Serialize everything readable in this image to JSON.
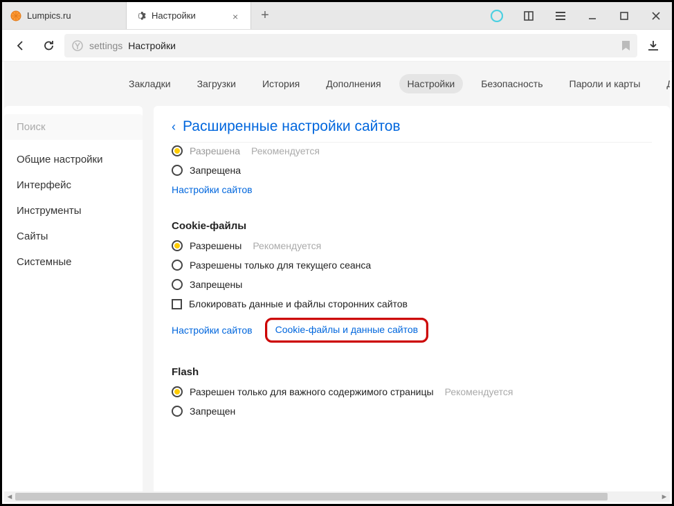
{
  "tabs": [
    {
      "title": "Lumpics.ru",
      "active": false
    },
    {
      "title": "Настройки",
      "active": true
    }
  ],
  "addr": {
    "prefix": "settings",
    "title": "Настройки"
  },
  "topnav": [
    "Закладки",
    "Загрузки",
    "История",
    "Дополнения",
    "Настройки",
    "Безопасность",
    "Пароли и карты",
    "Другие ус"
  ],
  "topnav_selected": 4,
  "sidebar": {
    "search_placeholder": "Поиск",
    "items": [
      "Общие настройки",
      "Интерфейс",
      "Инструменты",
      "Сайты",
      "Системные"
    ]
  },
  "main": {
    "header": "Расширенные настройки сайтов",
    "sections": {
      "top_cut": {
        "opts": [
          {
            "type": "radio",
            "label": "Разрешена",
            "rec": "Рекомендуется",
            "checked": true
          },
          {
            "type": "radio",
            "label": "Запрещена",
            "rec": "",
            "checked": false
          }
        ],
        "links": [
          "Настройки сайтов"
        ]
      },
      "cookies": {
        "title": "Cookie-файлы",
        "opts": [
          {
            "type": "radio",
            "label": "Разрешены",
            "rec": "Рекомендуется",
            "checked": true
          },
          {
            "type": "radio",
            "label": "Разрешены только для текущего сеанса",
            "rec": "",
            "checked": false
          },
          {
            "type": "radio",
            "label": "Запрещены",
            "rec": "",
            "checked": false
          },
          {
            "type": "checkbox",
            "label": "Блокировать данные и файлы сторонних сайтов",
            "rec": "",
            "checked": false
          }
        ],
        "links": [
          "Настройки сайтов",
          "Cookie-файлы и данные сайтов"
        ]
      },
      "flash": {
        "title": "Flash",
        "opts": [
          {
            "type": "radio",
            "label": "Разрешен только для важного содержимого страницы",
            "rec": "Рекомендуется",
            "checked": true
          },
          {
            "type": "radio",
            "label": "Запрещен",
            "rec": "",
            "checked": false
          }
        ]
      }
    }
  }
}
